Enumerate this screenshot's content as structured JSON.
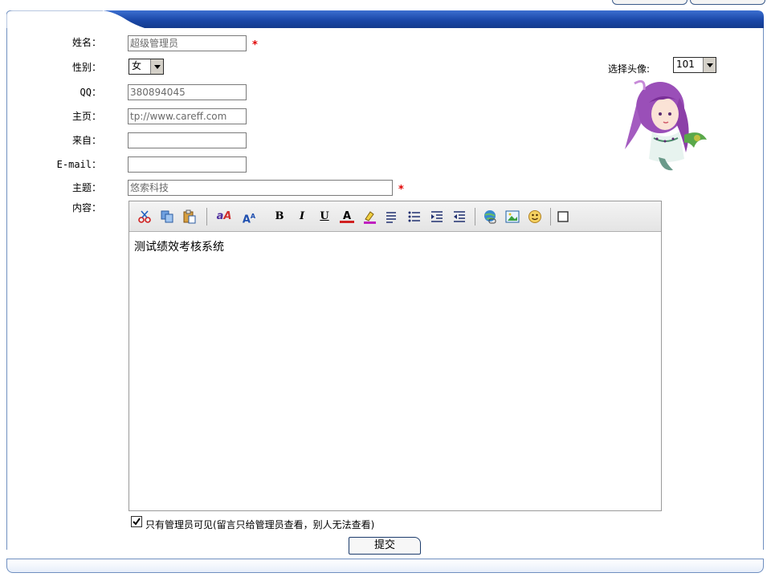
{
  "form": {
    "name": {
      "label": "姓名：",
      "value": "超级管理员",
      "required": "*"
    },
    "gender": {
      "label": "性别：",
      "value": "女"
    },
    "qq": {
      "label": "QQ：",
      "value": "380894045"
    },
    "homepage": {
      "label": "主页：",
      "value": "tp://www.careff.com"
    },
    "from": {
      "label": "来自：",
      "value": ""
    },
    "email": {
      "label": "E-mail：",
      "value": ""
    },
    "subject": {
      "label": "主题：",
      "value": "悠索科技",
      "required": "*"
    },
    "content": {
      "label": "内容：",
      "value": "测试绩效考核系统"
    },
    "avatar": {
      "label": "选择头像:",
      "value": "101"
    },
    "private_checkbox": {
      "checked": true,
      "label": "只有管理员可见(留言只给管理员查看，别人无法查看)"
    },
    "submit_label": "提交"
  },
  "toolbar": {
    "buttons": [
      "cut-icon",
      "copy-icon",
      "paste-icon",
      "font-icon",
      "font-size-icon",
      "bold-icon",
      "italic-icon",
      "underline-icon",
      "font-color-icon",
      "highlight-icon",
      "align-icon",
      "list-icon",
      "indent-icon",
      "outdent-icon",
      "link-icon",
      "image-icon",
      "emoticon-icon",
      "source-toggle-icon"
    ],
    "text": {
      "bold": "B",
      "italic": "I",
      "underline": "U",
      "color": "A"
    }
  },
  "colors": {
    "accent": "#1f4fa8",
    "required": "#e00000",
    "frame": "#6f8fc0"
  }
}
